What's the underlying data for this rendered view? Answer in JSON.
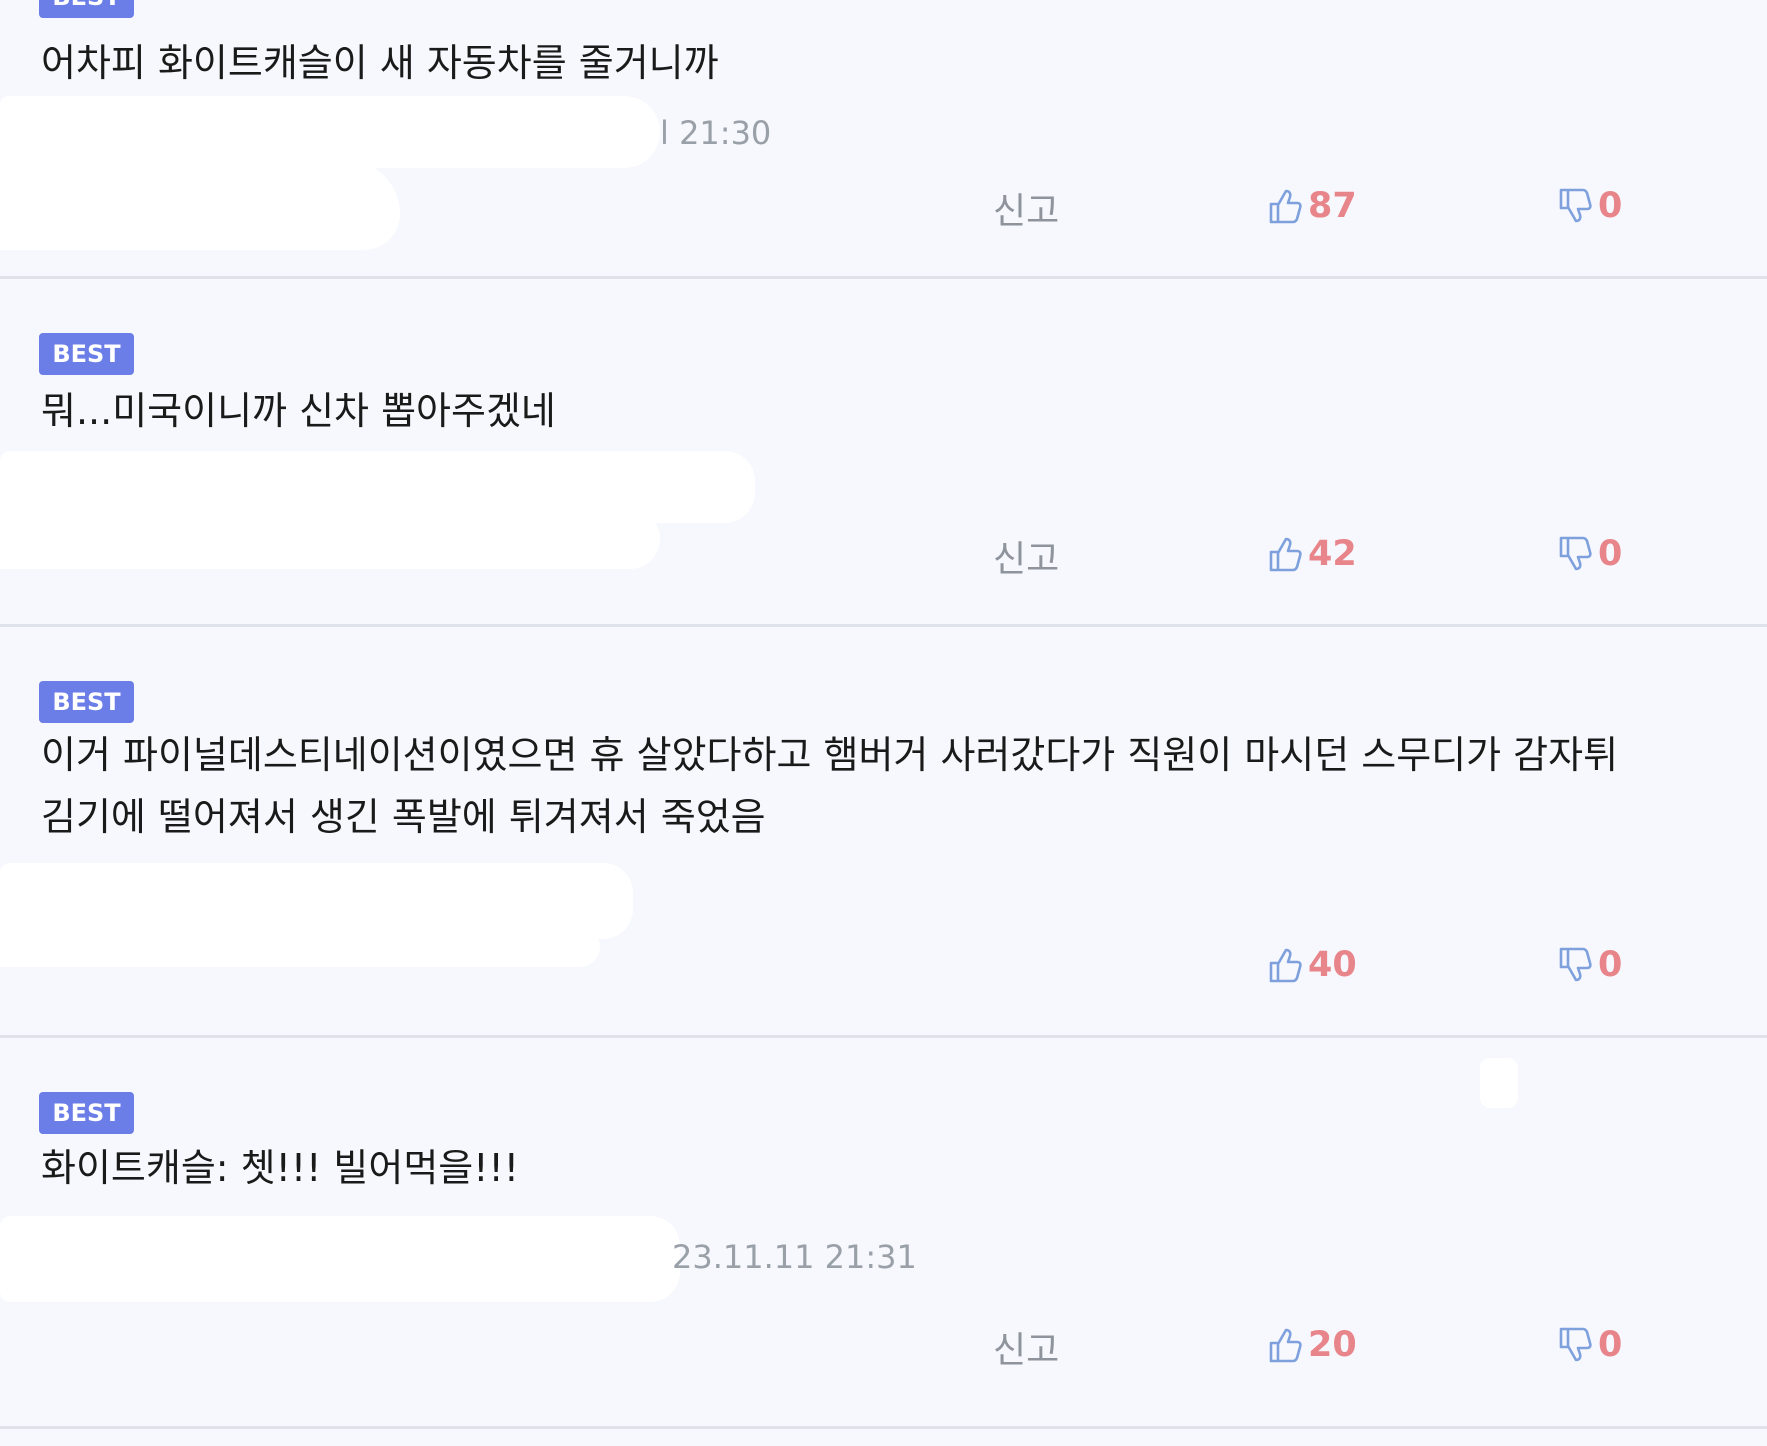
{
  "badge_label": "BEST",
  "report_label": "신고",
  "comments": [
    {
      "text_lines": [
        "어차피 화이트캐슬이 새 자동차를 줄거니까"
      ],
      "timestamp": "l 21:30",
      "likes": "87",
      "dislikes": "0"
    },
    {
      "text_lines": [
        "뭐...미국이니까 신차 뽑아주겠네"
      ],
      "timestamp": "",
      "likes": "42",
      "dislikes": "0"
    },
    {
      "text_lines": [
        "이거 파이널데스티네이션이였으면 휴 살았다하고 햄버거 사러갔다가 직원이 마시던 스무디가 감자튀",
        "김기에 떨어져서 생긴 폭발에 튀겨져서 죽었음"
      ],
      "timestamp": "",
      "likes": "40",
      "dislikes": "0"
    },
    {
      "text_lines": [
        "화이트캐슬: 쳇!!! 빌어먹을!!!"
      ],
      "timestamp": "23.11.11 21:31",
      "likes": "20",
      "dislikes": "0"
    }
  ],
  "colors": {
    "badge": "#6b7de6",
    "count": "#e8858a",
    "thumb": "#7ea0dc",
    "background": "#f6f8fd"
  }
}
